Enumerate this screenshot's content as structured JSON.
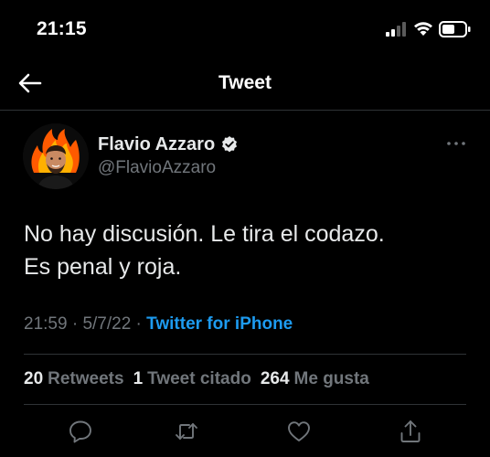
{
  "status_bar": {
    "time": "21:15",
    "icons": [
      "signal-icon",
      "wifi-icon",
      "battery-icon"
    ]
  },
  "nav": {
    "back_icon": "back-arrow-icon",
    "title": "Tweet"
  },
  "author": {
    "name": "Flavio Azzaro",
    "handle": "@FlavioAzzaro",
    "verified": true,
    "avatar_icon": "avatar-fire-portrait"
  },
  "tweet": {
    "lines": [
      "No hay discusión. Le tira el codazo.",
      "Es penal y roja."
    ]
  },
  "meta": {
    "time": "21:59",
    "separator": " · ",
    "date": "5/7/22",
    "source": "Twitter for iPhone"
  },
  "stats": {
    "retweets_count": "20",
    "retweets_label": "Retweets",
    "quotes_count": "1",
    "quotes_label": "Tweet citado",
    "likes_count": "264",
    "likes_label": "Me gusta"
  },
  "actions": [
    "reply-icon",
    "retweet-icon",
    "like-icon",
    "share-icon"
  ],
  "colors": {
    "background": "#000000",
    "text_primary": "#e7e9ea",
    "text_secondary": "#71767b",
    "accent": "#1d9bf0",
    "divider": "#2f3336",
    "avatar_fire": "#ff6a00"
  }
}
